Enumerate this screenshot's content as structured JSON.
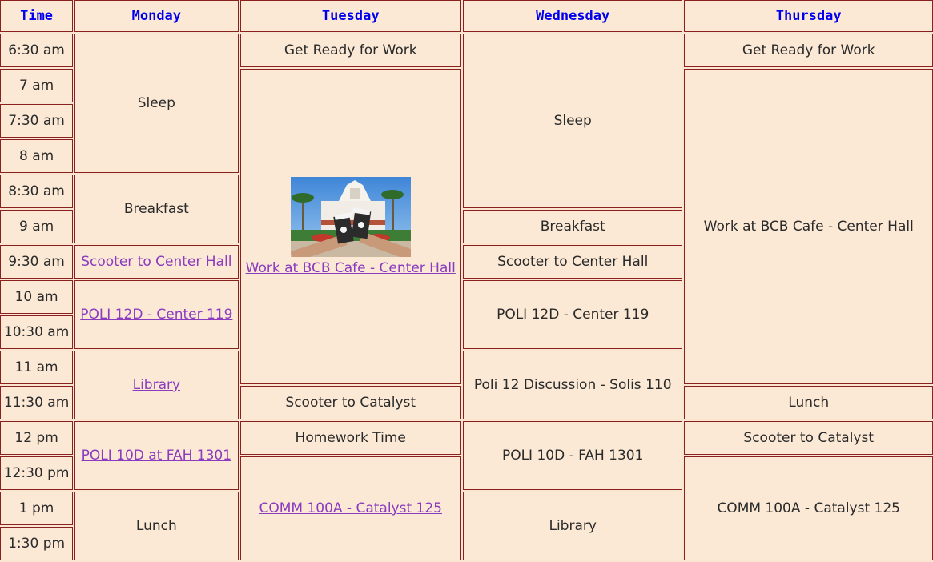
{
  "headers": [
    "Time",
    "Monday",
    "Tuesday",
    "Wednesday",
    "Thursday"
  ],
  "times": [
    "6:30 am",
    "7 am",
    "7:30 am",
    "8 am",
    "8:30 am",
    "9 am",
    "9:30 am",
    "10 am",
    "10:30 am",
    "11 am",
    "11:30 am",
    "12 pm",
    "12:30 pm",
    "1 pm",
    "1:30 pm"
  ],
  "monday": {
    "sleep": "Sleep",
    "breakfast": "Breakfast",
    "scooter": "Scooter to Center Hall",
    "poli12d": "POLI 12D - Center 119",
    "library": "Library",
    "poli10d": "POLI 10D at FAH 1301",
    "lunch": "Lunch"
  },
  "tuesday": {
    "get_ready": "Get Ready for Work",
    "work": "Work at BCB Cafe - Center Hall",
    "scooter": "Scooter to Catalyst",
    "homework": "Homework Time",
    "comm": "COMM 100A - Catalyst 125"
  },
  "wednesday": {
    "sleep": "Sleep",
    "breakfast": "Breakfast",
    "scooter": "Scooter to Center Hall",
    "poli12d": "POLI 12D - Center 119",
    "discussion": "Poli 12 Discussion - Solis 110",
    "poli10d": "POLI 10D - FAH 1301",
    "library": "Library"
  },
  "thursday": {
    "get_ready": "Get Ready for Work",
    "work": "Work at BCB Cafe - Center Hall",
    "lunch": "Lunch",
    "scooter": "Scooter to Catalyst",
    "comm": "COMM 100A - Catalyst 125"
  },
  "colors": {
    "border": "#8a2020",
    "cell_bg": "#fbe9d5",
    "header_text": "#0000ee",
    "link_text": "#8b3bbf"
  },
  "image": {
    "alt": "coffee cups in front of Center Hall",
    "icon": "photo-icon"
  }
}
